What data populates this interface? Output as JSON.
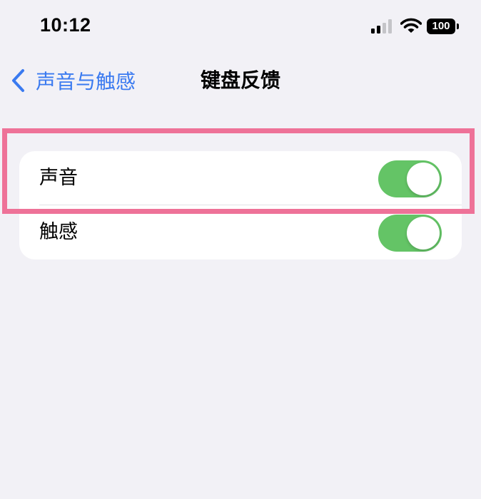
{
  "status_bar": {
    "time": "10:12",
    "battery": "100",
    "icons": [
      "signal-icon",
      "wifi-icon",
      "battery-icon"
    ]
  },
  "nav": {
    "back_label": "声音与触感",
    "back_icon": "chevron-left-icon",
    "title": "键盘反馈"
  },
  "settings": {
    "rows": [
      {
        "label": "声音",
        "toggle_on": true
      },
      {
        "label": "触感",
        "toggle_on": true
      }
    ]
  },
  "colors": {
    "background": "#f2f1f6",
    "accent": "#3a7af0",
    "toggle_on": "#64c466",
    "highlight": "#ee7298"
  }
}
